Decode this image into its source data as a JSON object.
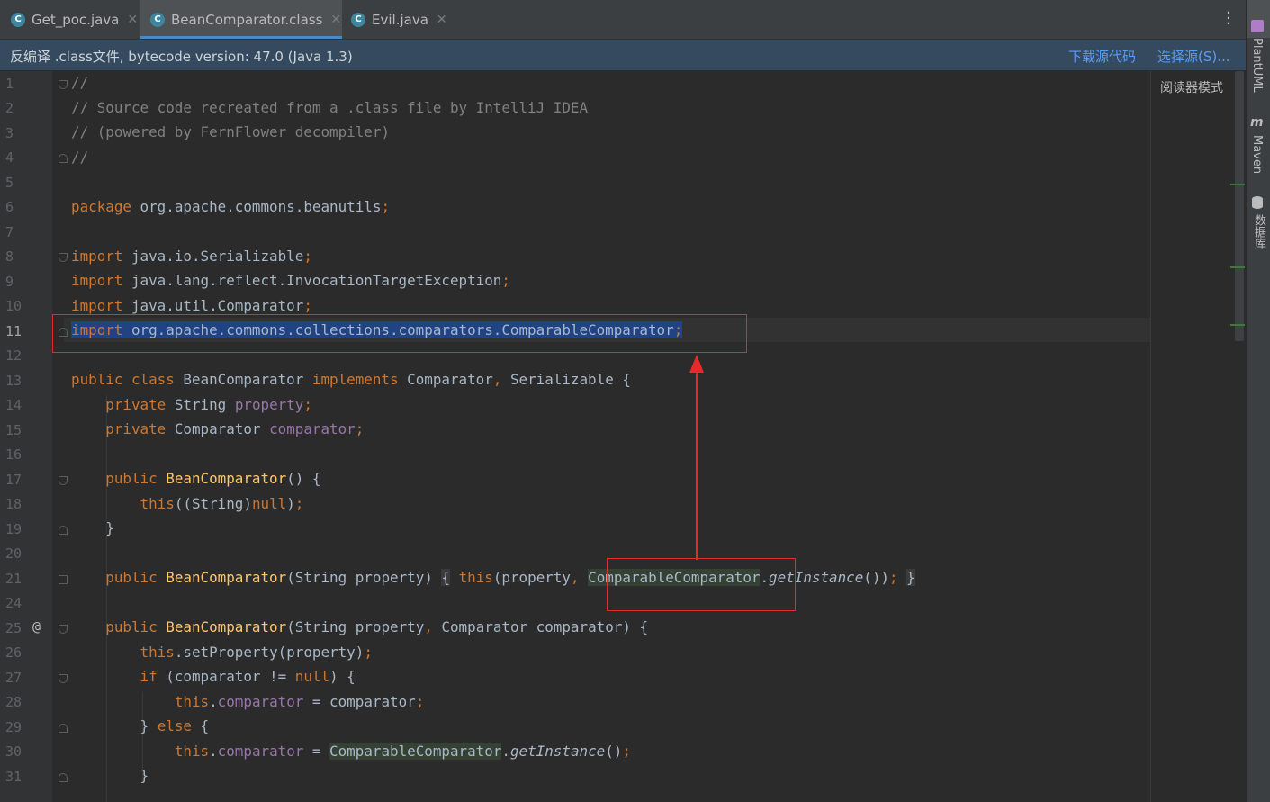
{
  "tabs": [
    {
      "label": "Get_poc.java",
      "icon": "C"
    },
    {
      "label": "BeanComparator.class",
      "icon": "C"
    },
    {
      "label": "Evil.java",
      "icon": "C"
    }
  ],
  "notice": {
    "message": "反编译 .class文件, bytecode version: 47.0 (Java 1.3)",
    "download_link": "下载源代码",
    "choose_link": "选择源(S)..."
  },
  "reader_mode": "阅读器模式",
  "right_tools": {
    "plantuml": "PlantUML",
    "maven": "Maven",
    "database": "数据库"
  },
  "gutter": {
    "line_numbers": [
      "1",
      "2",
      "3",
      "4",
      "5",
      "6",
      "7",
      "8",
      "9",
      "10",
      "11",
      "12",
      "13",
      "14",
      "15",
      "16",
      "17",
      "18",
      "19",
      "20",
      "21",
      "24",
      "25",
      "26",
      "27",
      "28",
      "29",
      "30",
      "31"
    ],
    "override_marker": "@"
  },
  "code": {
    "l1": "//",
    "l2": "// Source code recreated from a .class file by IntelliJ IDEA",
    "l3": "// (powered by FernFlower decompiler)",
    "l4": "//",
    "l6_kw": "package",
    "l6_rest": " org.apache.commons.beanutils",
    "semi": ";",
    "import_kw": "import",
    "l8": " java.io.Serializable",
    "l9": " java.lang.reflect.InvocationTargetException",
    "l10": " java.util.Comparator",
    "l11": " org.apache.commons.collections.comparators.ComparableComparator",
    "l13_kw1": "public class",
    "l13_name": " BeanComparator ",
    "l13_kw2": "implements",
    "l13_rest1": " Comparator",
    "l13_comma": ",",
    "l13_rest2": " Serializable {",
    "private_kw": "private",
    "l14_type": " String ",
    "l14_field": "property",
    "l15_type": " Comparator ",
    "l15_field": "comparator",
    "public_kw": "public",
    "ctor": " BeanComparator",
    "l17_rest": "() {",
    "this_kw": "this",
    "l18_mid": "((String)",
    "null_kw": "null",
    "l18_end": ")",
    "close_brace": "}",
    "l21_params": "(String property)",
    "l21_open": "{",
    "l21_a": "(property",
    "comma": ",",
    "cc": "ComparableComparator",
    "get_instance": "getInstance",
    "l21_b": "())",
    "l25_params1": "(String property",
    "l25_params2": " Comparator comparator) {",
    "l26_rest": ".setProperty(property)",
    "if_kw": "if",
    "l27_a": " (comparator != ",
    "l27_b": ") {",
    "l28_field": "comparator",
    "l28_rest": " = comparator",
    "else_kw": "else",
    "l30_eq": " = ",
    "l30_end": "()"
  },
  "colors": {
    "background": "#2b2b2b",
    "keyword": "#cc7832",
    "comment": "#808080",
    "method": "#ffc66d",
    "field": "#9876aa",
    "text": "#a9b7c6",
    "annotation_red": "#e8292b",
    "link": "#589df6"
  }
}
